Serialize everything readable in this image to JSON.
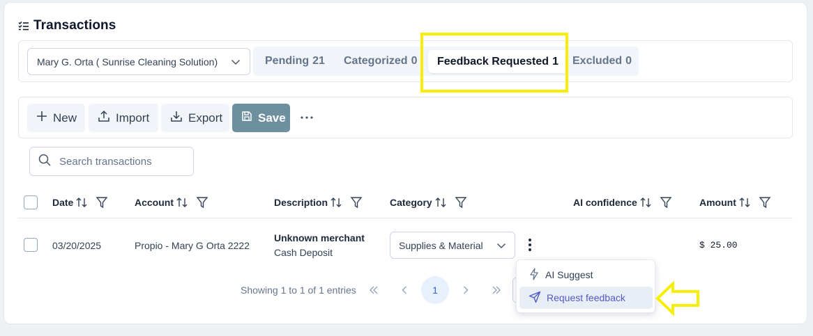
{
  "page": {
    "title": "Transactions"
  },
  "client_select": {
    "value": "Mary G. Orta ( Sunrise Cleaning Solution)"
  },
  "tabs": [
    {
      "label": "Pending",
      "count": "21"
    },
    {
      "label": "Categorized",
      "count": "0"
    },
    {
      "label": "Feedback Requested",
      "count": "1",
      "active": true
    },
    {
      "label": "Excluded",
      "count": "0"
    }
  ],
  "toolbar": {
    "new": "New",
    "import": "Import",
    "export": "Export",
    "save": "Save"
  },
  "search": {
    "placeholder": "Search transactions"
  },
  "table": {
    "columns": [
      "Date",
      "Account",
      "Description",
      "Category",
      "AI confidence",
      "Amount"
    ],
    "rows": [
      {
        "date": "03/20/2025",
        "account": "Propio - Mary G Orta 2222",
        "merchant": "Unknown merchant",
        "description": "Cash Deposit",
        "category": "Supplies & Material",
        "ai_confidence": "",
        "amount": "$ 25.00"
      }
    ]
  },
  "pagination": {
    "text": "Showing 1 to 1 of 1 entries",
    "current_page": "1"
  },
  "row_menu": {
    "items": [
      "AI Suggest",
      "Request feedback"
    ]
  },
  "colors": {
    "highlight": "#f6f000",
    "save_button": "#6e8f9d",
    "active_page": "#2563eb",
    "menu_hover_text": "#4f59c4"
  }
}
